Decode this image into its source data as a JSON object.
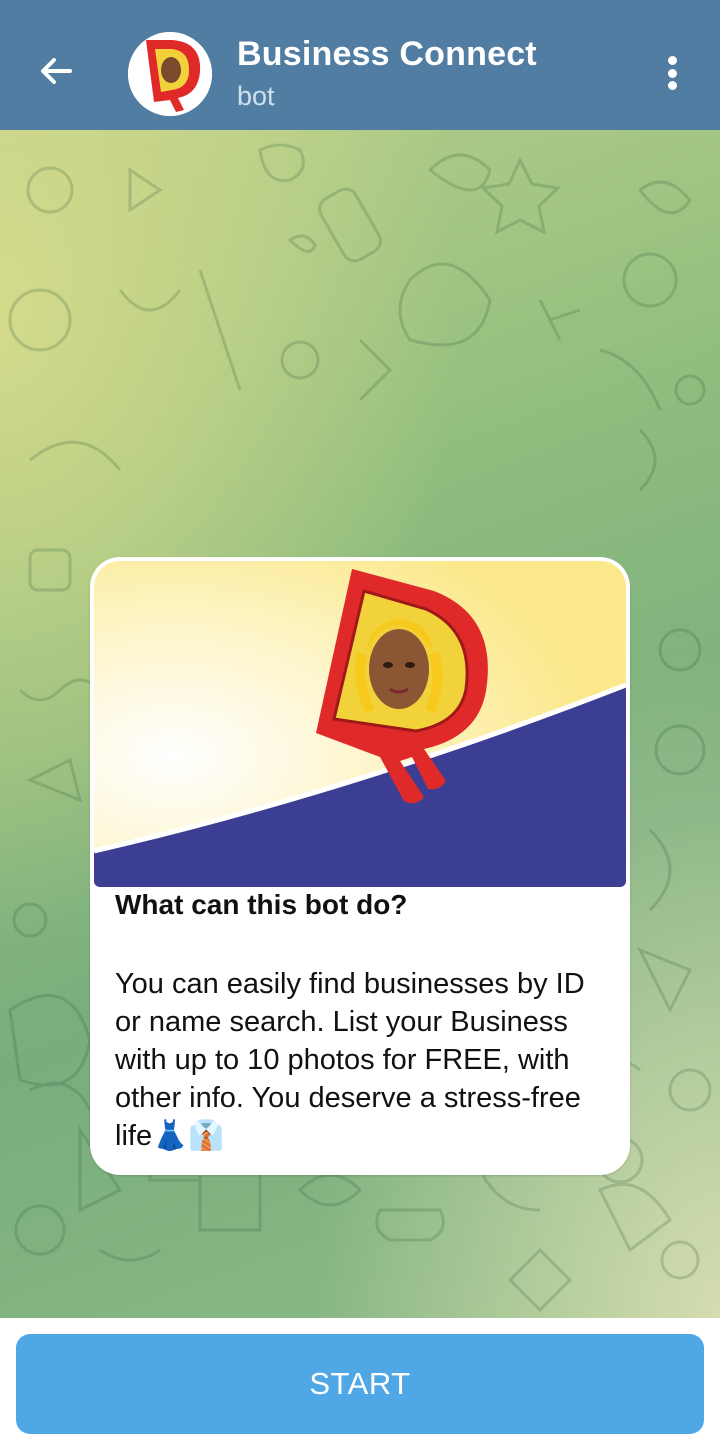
{
  "header": {
    "title": "Business Connect",
    "subtitle": "bot"
  },
  "intro": {
    "heading": "What can this bot do?",
    "description": "You can easily find businesses by ID or name search. List your Business with up to 10 photos for FREE, with other info. You deserve a stress-free life👗👔"
  },
  "footer": {
    "start_label": "START"
  },
  "colors": {
    "header_bg": "#517da2",
    "start_button": "#50a7e6",
    "logo_red": "#e02a2a",
    "banner_navy": "#3b3e93"
  },
  "icons": [
    "back-arrow-icon",
    "more-vert-icon"
  ]
}
